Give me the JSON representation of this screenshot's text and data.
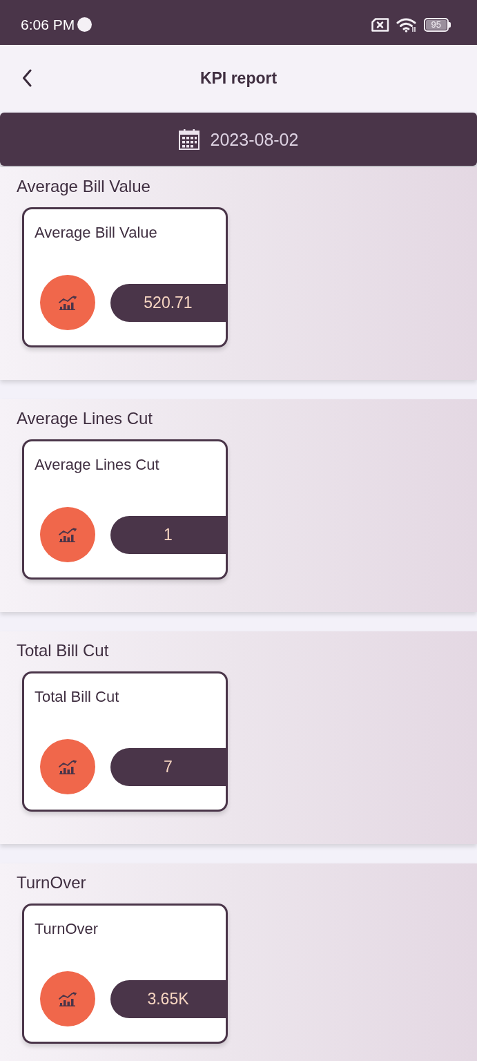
{
  "status_bar": {
    "time": "6:06 PM",
    "battery": "95"
  },
  "header": {
    "title": "KPI report"
  },
  "date_bar": {
    "date": "2023-08-02"
  },
  "sections": [
    {
      "title": "Average Bill Value",
      "card": {
        "label": "Average Bill Value",
        "value": "520.71"
      }
    },
    {
      "title": "Average Lines Cut",
      "card": {
        "label": "Average Lines Cut",
        "value": "1"
      }
    },
    {
      "title": "Total Bill Cut",
      "card": {
        "label": "Total Bill Cut",
        "value": "7"
      }
    },
    {
      "title": "TurnOver",
      "card": {
        "label": "TurnOver",
        "value": "3.65K"
      }
    }
  ]
}
